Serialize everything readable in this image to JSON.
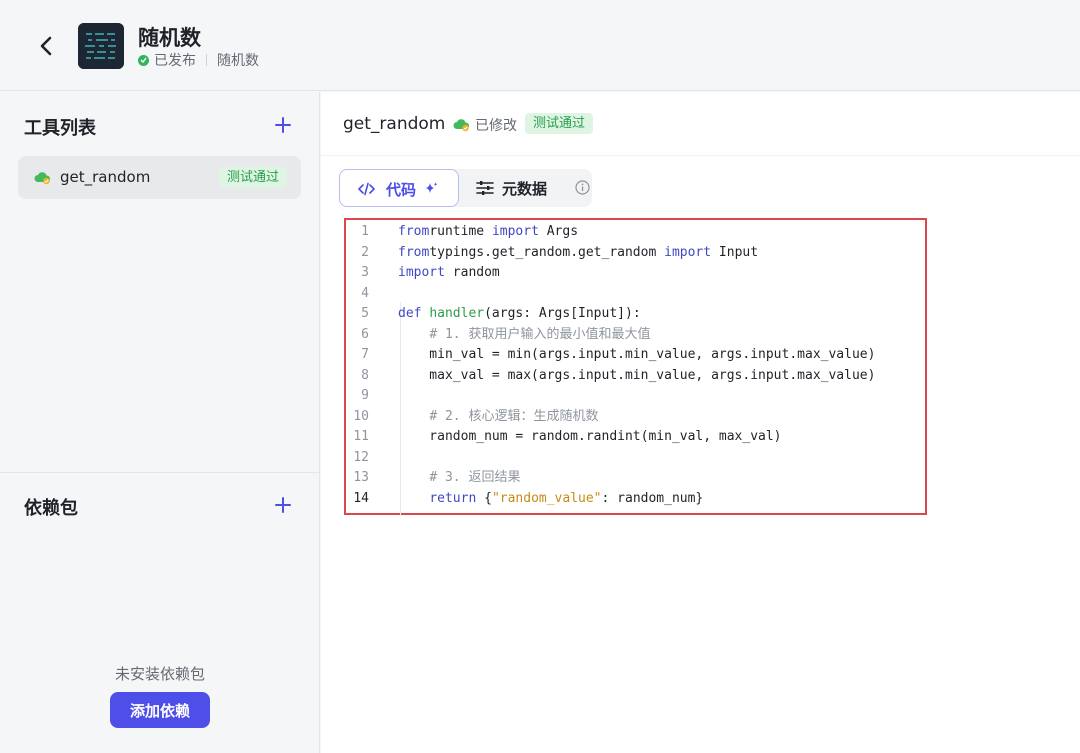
{
  "header": {
    "app_name": "随机数",
    "status": "已发布",
    "subtitle": "随机数"
  },
  "sidebar": {
    "tools_title": "工具列表",
    "tools": [
      {
        "name": "get_random",
        "badge": "测试通过"
      }
    ],
    "deps_title": "依赖包",
    "deps_empty": "未安装依赖包",
    "add_dep_label": "添加依赖"
  },
  "main": {
    "function_name": "get_random",
    "modified_label": "已修改",
    "test_badge": "测试通过",
    "tabs": [
      {
        "label": "代码"
      },
      {
        "label": "元数据"
      }
    ],
    "active_line": 14
  },
  "code_lines": [
    [
      [
        "kw",
        "from"
      ],
      [
        "",
        "runtime "
      ],
      [
        "kw",
        "import"
      ],
      [
        "",
        " Args"
      ]
    ],
    [
      [
        "kw",
        "from"
      ],
      [
        "",
        "typings.get_random.get_random "
      ],
      [
        "kw",
        "import"
      ],
      [
        "",
        " Input"
      ]
    ],
    [
      [
        "kw",
        "import"
      ],
      [
        "",
        " random"
      ]
    ],
    [],
    [
      [
        "kw",
        "def"
      ],
      [
        "",
        " "
      ],
      [
        "fn",
        "handler"
      ],
      [
        "",
        "(args: Args[Input]):"
      ]
    ],
    [
      [
        "",
        "    "
      ],
      [
        "cm",
        "# 1. 获取用户输入的最小值和最大值"
      ]
    ],
    [
      [
        "",
        "    min_val = min(args.input.min_value, args.input.max_value)"
      ]
    ],
    [
      [
        "",
        "    max_val = max(args.input.min_value, args.input.max_value)"
      ]
    ],
    [],
    [
      [
        "",
        "    "
      ],
      [
        "cm",
        "# 2. 核心逻辑：生成随机数"
      ]
    ],
    [
      [
        "",
        "    random_num = random.randint(min_val, max_val)"
      ]
    ],
    [],
    [
      [
        "",
        "    "
      ],
      [
        "cm",
        "# 3. 返回结果"
      ]
    ],
    [
      [
        "",
        "    "
      ],
      [
        "kw",
        "return"
      ],
      [
        "",
        " {"
      ],
      [
        "str",
        "\"random_value\""
      ],
      [
        "",
        ": random_num}"
      ]
    ]
  ],
  "colors": {
    "accent": "#4e4ee8",
    "success": "#2a9d4b",
    "success_bg": "#def5e4",
    "highlight_border": "#d9484a"
  }
}
